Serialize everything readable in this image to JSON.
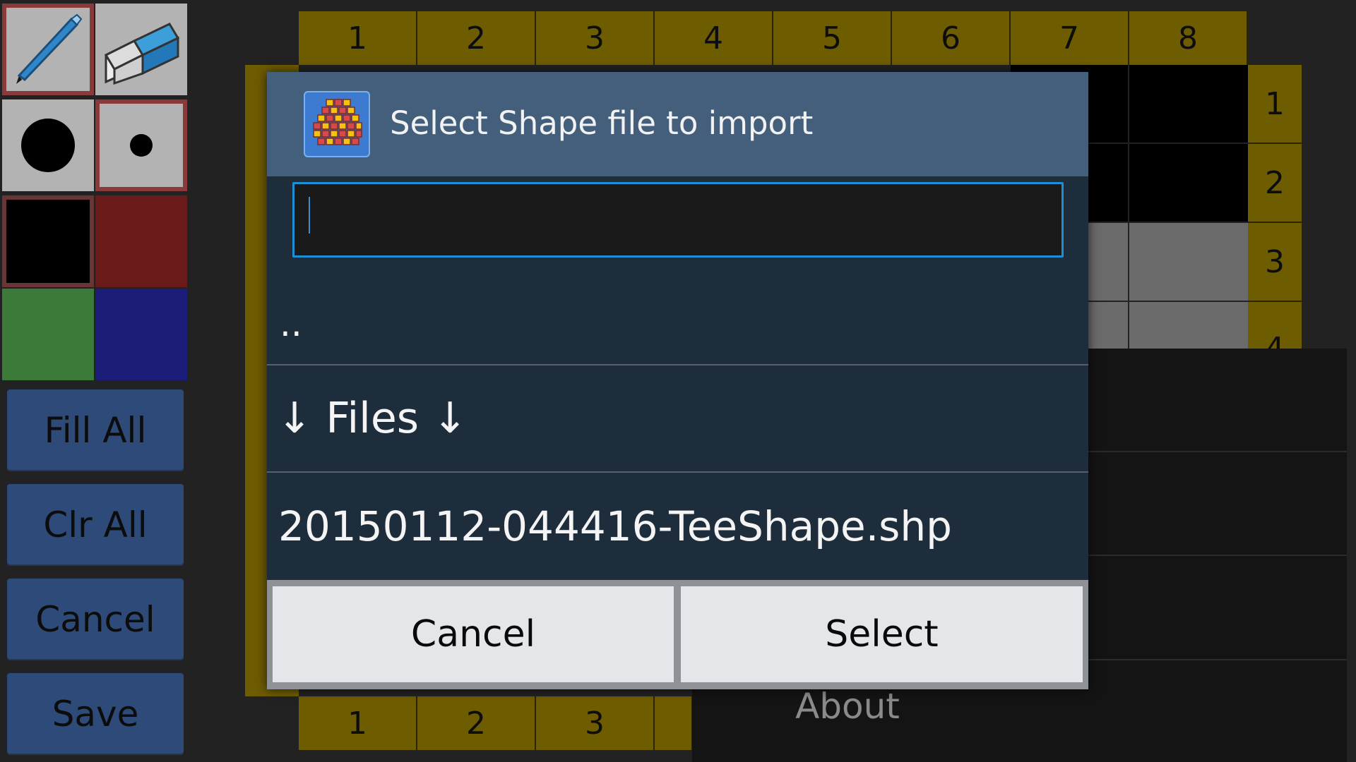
{
  "tools": {
    "pencil_icon": "pencil-icon",
    "eraser_icon": "eraser-icon",
    "large_brush_icon": "large-dot-icon",
    "small_brush_icon": "small-dot-icon"
  },
  "colors": {
    "black": "#000000",
    "red": "#6b1a1a",
    "green": "#3c7a3a",
    "blue": "#1c1d78"
  },
  "sidebar": {
    "fill_all": "Fill All",
    "clr_all": "Clr All",
    "cancel": "Cancel",
    "save": "Save"
  },
  "grid": {
    "top_columns": [
      "1",
      "2",
      "3",
      "4",
      "5",
      "6",
      "7",
      "8"
    ],
    "right_rows": [
      "1",
      "2",
      "3",
      "4"
    ],
    "bottom_columns": [
      "1",
      "2",
      "3"
    ]
  },
  "menu": {
    "about": "About"
  },
  "dialog": {
    "title": "Select Shape file to import",
    "input_value": "",
    "parent_dir": "..",
    "files_header": "↓ Files ↓",
    "file_name": "20150112-044416-TeeShape.shp",
    "cancel_label": "Cancel",
    "select_label": "Select"
  }
}
